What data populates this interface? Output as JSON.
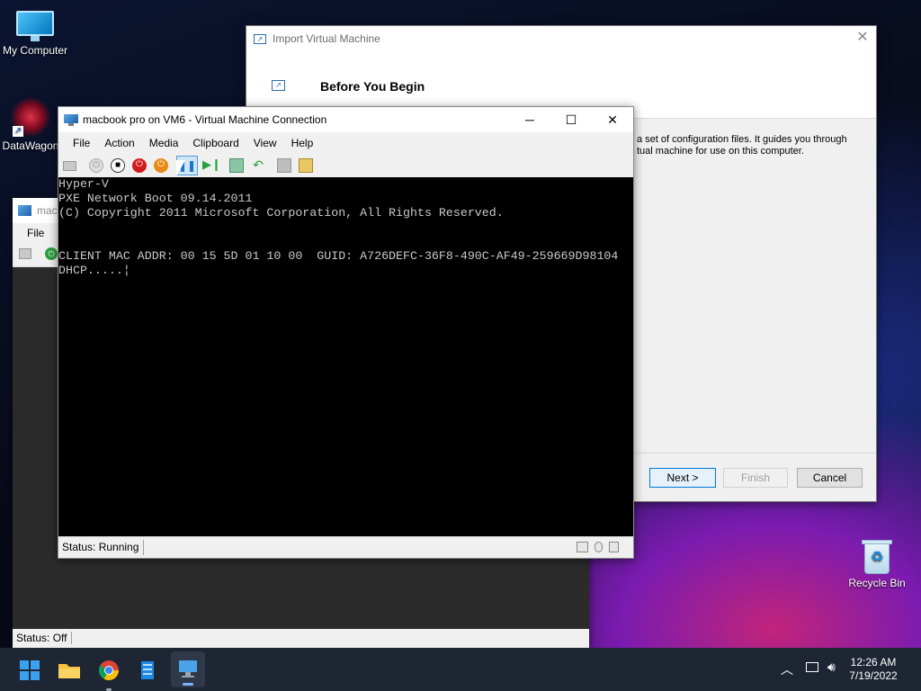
{
  "desktop": {
    "icons": [
      {
        "label": "My Computer"
      },
      {
        "label": "DataWagon"
      },
      {
        "label": "Recycle Bin"
      }
    ]
  },
  "wizard": {
    "title": "Import Virtual Machine",
    "heading": "Before You Begin",
    "description_line1": "a set of configuration files. It guides you through",
    "description_line2": "tual machine for use on this computer.",
    "buttons": {
      "next": "Next >",
      "finish": "Finish",
      "cancel": "Cancel"
    }
  },
  "bg_vm": {
    "title": "mac",
    "menu": "File",
    "status": "Status: Off"
  },
  "vm": {
    "title": "macbook pro on VM6 - Virtual Machine Connection",
    "menu": [
      "File",
      "Action",
      "Media",
      "Clipboard",
      "View",
      "Help"
    ],
    "console_lines": [
      "Hyper-V",
      "PXE Network Boot 09.14.2011",
      "(C) Copyright 2011 Microsoft Corporation, All Rights Reserved.",
      "",
      "",
      "CLIENT MAC ADDR: 00 15 5D 01 10 00  GUID: A726DEFC-36F8-490C-AF49-259669D98104",
      "DHCP.....¦"
    ],
    "status": "Status: Running"
  },
  "taskbar": {
    "clock_time": "12:26 AM",
    "clock_date": "7/19/2022"
  },
  "colors": {
    "accent": "#0078d7",
    "taskbar": "#1e2633",
    "console_bg": "#000000",
    "console_fg": "#c8c8c8"
  }
}
